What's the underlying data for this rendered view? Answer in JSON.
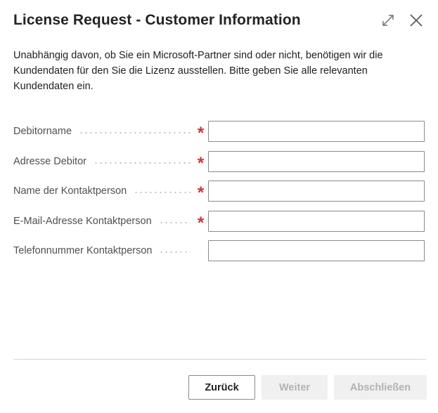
{
  "dialog": {
    "title": "License Request - Customer Information",
    "description": "Unabhängig davon, ob Sie ein Microsoft-Partner sind oder nicht, benötigen wir die Kundendaten für den Sie die Lizenz ausstellen. Bitte geben Sie alle relevanten Kundendaten ein.",
    "icons": {
      "expand": "expand-icon",
      "close": "close-icon"
    }
  },
  "form": {
    "fields": [
      {
        "label": "Debitorname",
        "required": true,
        "value": ""
      },
      {
        "label": "Adresse Debitor",
        "required": true,
        "value": ""
      },
      {
        "label": "Name der Kontaktperson",
        "required": true,
        "value": ""
      },
      {
        "label": "E-Mail-Adresse Kontaktperson",
        "required": true,
        "value": ""
      },
      {
        "label": "Telefonnummer Kontaktperson",
        "required": false,
        "value": ""
      }
    ],
    "required_marker": "*"
  },
  "footer": {
    "back_label": "Zurück",
    "next_label": "Weiter",
    "finish_label": "Abschließen"
  },
  "colors": {
    "required": "#d13438",
    "disabled_button_bg": "#f0f0f0",
    "disabled_button_text": "#b3b3b3"
  }
}
